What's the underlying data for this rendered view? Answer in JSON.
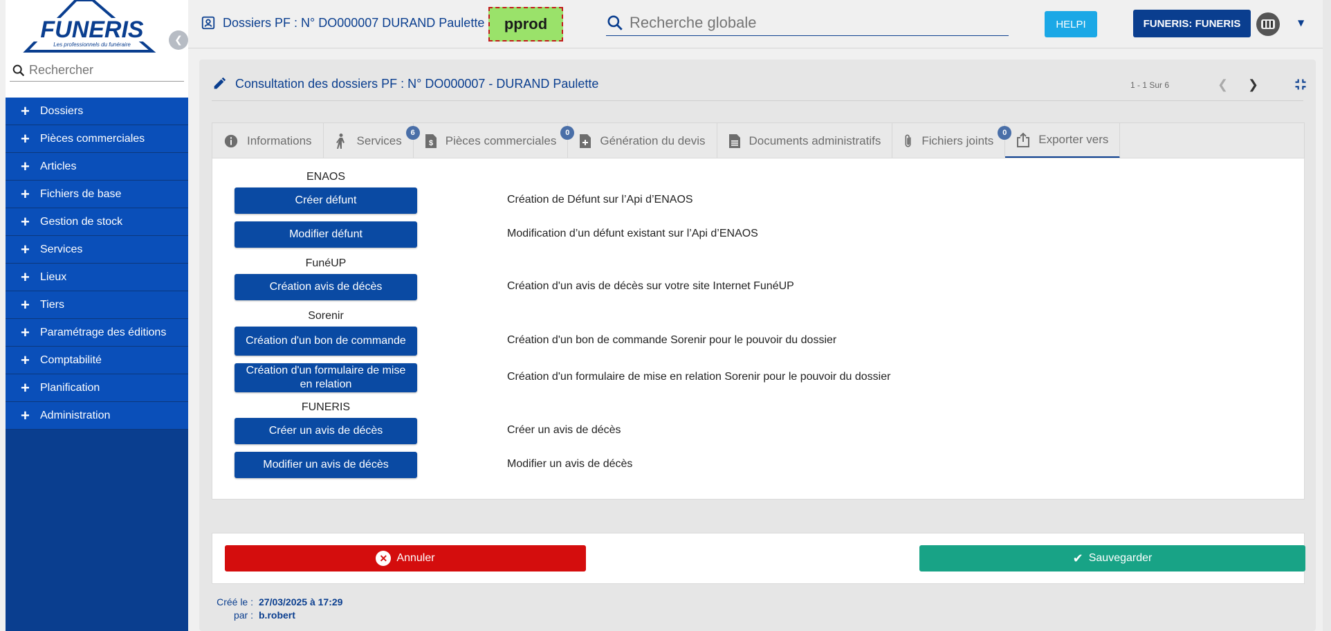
{
  "app": {
    "logo_text": "FUNERIS",
    "logo_tagline": "Les professionnels du funéraire"
  },
  "sidebar": {
    "search_placeholder": "Rechercher",
    "items": [
      {
        "label": "Dossiers"
      },
      {
        "label": "Pièces commerciales"
      },
      {
        "label": "Articles"
      },
      {
        "label": "Fichiers de base"
      },
      {
        "label": "Gestion de stock"
      },
      {
        "label": "Services"
      },
      {
        "label": "Lieux"
      },
      {
        "label": "Tiers"
      },
      {
        "label": "Paramétrage des éditions"
      },
      {
        "label": "Comptabilité"
      },
      {
        "label": "Planification"
      },
      {
        "label": "Administration"
      }
    ]
  },
  "topbar": {
    "breadcrumb": "Dossiers PF : N° DO000007 DURAND Paulette",
    "env_badge": "pprod",
    "global_search_placeholder": "Recherche globale",
    "help_label": "HELPI",
    "company_label": "FUNERIS: FUNERIS"
  },
  "panel": {
    "title": "Consultation des dossiers PF : N° DO000007 - DURAND Paulette",
    "pager": "1 - 1 Sur 6"
  },
  "tabs": [
    {
      "label": "Informations",
      "icon": "info-icon",
      "badge": null
    },
    {
      "label": "Services",
      "icon": "person-icon",
      "badge": "6"
    },
    {
      "label": "Pièces commerciales",
      "icon": "invoice-icon",
      "badge": "0"
    },
    {
      "label": "Génération du devis",
      "icon": "file-plus-icon",
      "badge": null
    },
    {
      "label": "Documents administratifs",
      "icon": "document-icon",
      "badge": null
    },
    {
      "label": "Fichiers joints",
      "icon": "paperclip-icon",
      "badge": "0"
    },
    {
      "label": "Exporter vers",
      "icon": "export-icon",
      "badge": null
    }
  ],
  "content": {
    "sections": {
      "enaos": "ENAOS",
      "funeup": "FunéUP",
      "sorenir": "Sorenir",
      "funeris": "FUNERIS"
    },
    "actions": {
      "creer_defunt": {
        "label": "Créer défunt",
        "desc": "Création de Défunt sur l’Api d’ENAOS"
      },
      "modifier_defunt": {
        "label": "Modifier défunt",
        "desc": "Modification d’un défunt existant sur l’Api d’ENAOS"
      },
      "creation_avis": {
        "label": "Création avis de décès",
        "desc": "Création d'un avis de décès sur votre site Internet FunéUP"
      },
      "bon_commande": {
        "label": "Création d'un bon de commande",
        "desc": "Création d'un bon de commande Sorenir pour le pouvoir du dossier"
      },
      "formulaire_relation": {
        "label": "Création d'un formulaire de mise en relation",
        "desc": "Création d'un formulaire de mise en relation Sorenir pour le pouvoir du dossier"
      },
      "creer_avis": {
        "label": "Créer un avis de décès",
        "desc": "Créer un avis de décès"
      },
      "modifier_avis": {
        "label": "Modifier un avis de décès",
        "desc": "Modifier un avis de décès"
      }
    }
  },
  "footer": {
    "cancel_label": "Annuler",
    "save_label": "Sauvegarder",
    "created_label": "Créé le :",
    "created_value": "27/03/2025 à 17:29",
    "by_label": "par :",
    "by_value": "b.robert"
  },
  "colors": {
    "primary": "#0a3e8f",
    "danger": "#d40d0d",
    "success": "#18a386",
    "env_badge": "#9ae26a"
  }
}
